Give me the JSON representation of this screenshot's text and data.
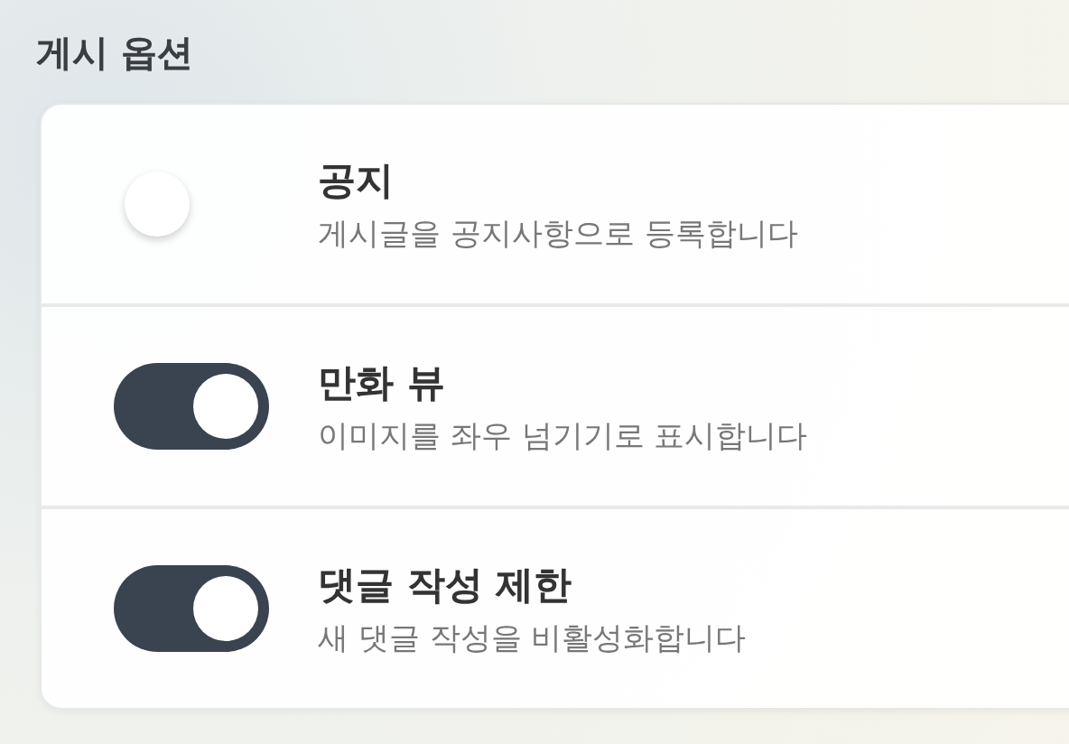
{
  "section_title": "게시 옵션",
  "options": [
    {
      "title": "공지",
      "description": "게시글을 공지사항으로 등록합니다",
      "on": false
    },
    {
      "title": "만화 뷰",
      "description": "이미지를 좌우 넘기기로 표시합니다",
      "on": true
    },
    {
      "title": "댓글 작성 제한",
      "description": "새 댓글 작성을 비활성화합니다",
      "on": true
    }
  ]
}
